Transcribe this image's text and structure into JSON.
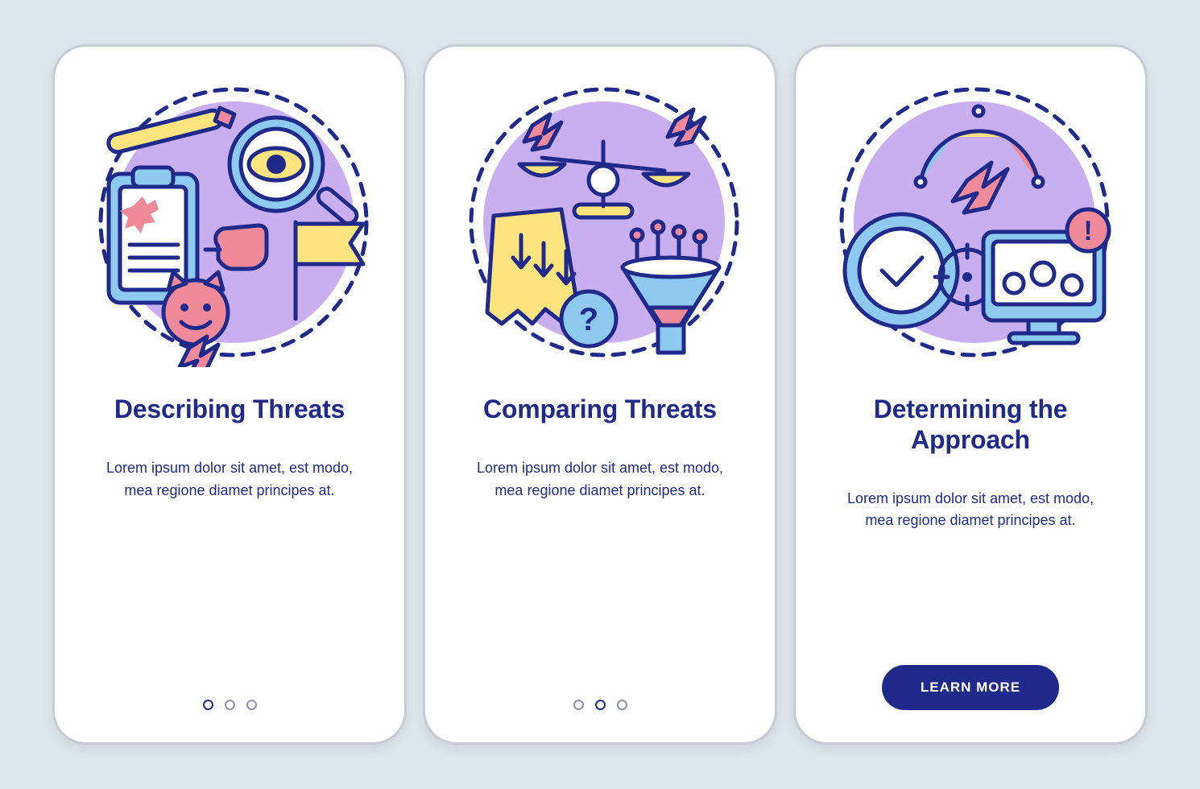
{
  "colors": {
    "background": "#dde7eb",
    "card": "#ffffff",
    "stroke": "#1f2a8a",
    "accent_purple": "#c9aef0",
    "yellow": "#fde47f",
    "blue": "#8ec9ef",
    "pink": "#f08a9b",
    "dot_inactive": "#8a92aa",
    "cta_bg": "#1f2a8a",
    "cta_text": "#ffffff"
  },
  "screens": [
    {
      "title": "Describing Threats",
      "body": "Lorem ipsum dolor sit amet, est modo, mea regione diamet principes at.",
      "dots": {
        "count": 3,
        "active": 0
      },
      "illustration_icons": [
        "pen-icon",
        "clipboard-icon",
        "lightning-icon",
        "magnifier-eye-icon",
        "pointing-hand-icon",
        "flag-icon",
        "devil-icon",
        "circle-bg-icon"
      ]
    },
    {
      "title": "Comparing Threats",
      "body": "Lorem ipsum dolor sit amet, est modo, mea regione diamet principes at.",
      "dots": {
        "count": 3,
        "active": 1
      },
      "illustration_icons": [
        "scale-icon",
        "lightning-icon",
        "torn-paper-icon",
        "arrows-down-icon",
        "question-badge-icon",
        "map-pins-icon",
        "funnel-icon",
        "circle-bg-icon"
      ]
    },
    {
      "title": "Determining the Approach",
      "body": "Lorem ipsum dolor sit amet, est modo, mea regione diamet principes at.",
      "cta_label": "LEARN MORE",
      "illustration_icons": [
        "gauge-icon",
        "lightning-icon",
        "clock-check-icon",
        "crosshair-icon",
        "monitor-gears-icon",
        "alert-badge-icon",
        "circle-bg-icon"
      ]
    }
  ]
}
